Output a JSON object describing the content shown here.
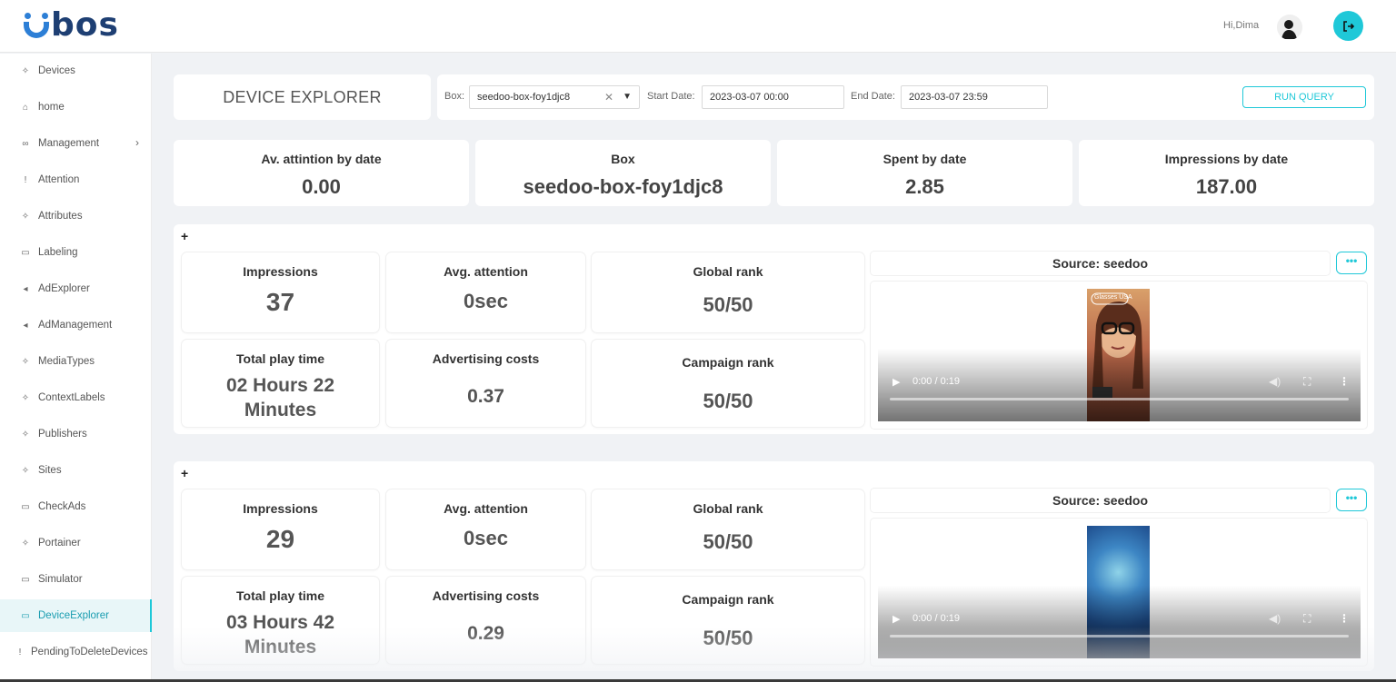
{
  "header": {
    "logo_text": "bos",
    "greeting": "Hi,Dima",
    "brand_color": "#1e3f73",
    "accent_color": "#1fc8d8",
    "avatar_icon": "user-avatar",
    "logout_icon": "logout-icon"
  },
  "sidebar": {
    "items": [
      {
        "label": "Devices",
        "icon": "sparkle-icon"
      },
      {
        "label": "home",
        "icon": "home-icon"
      },
      {
        "label": "Management",
        "icon": "users-icon"
      },
      {
        "label": "Attention",
        "icon": "exclamation-icon"
      },
      {
        "label": "Attributes",
        "icon": "sparkle-icon"
      },
      {
        "label": "Labeling",
        "icon": "tag-icon"
      },
      {
        "label": "AdExplorer",
        "icon": "megaphone-icon"
      },
      {
        "label": "AdManagement",
        "icon": "megaphone-icon"
      },
      {
        "label": "MediaTypes",
        "icon": "sparkle-icon"
      },
      {
        "label": "ContextLabels",
        "icon": "sparkle-icon"
      },
      {
        "label": "Publishers",
        "icon": "sparkle-icon"
      },
      {
        "label": "Sites",
        "icon": "sparkle-icon"
      },
      {
        "label": "CheckAds",
        "icon": "tag-icon"
      },
      {
        "label": "Portainer",
        "icon": "sparkle-icon"
      },
      {
        "label": "Simulator",
        "icon": "tag-icon"
      },
      {
        "label": "DeviceExplorer",
        "icon": "tag-icon"
      },
      {
        "label": "PendingToDeleteDevices",
        "icon": "exclamation-icon"
      }
    ],
    "active": "DeviceExplorer"
  },
  "page": {
    "title": "DEVICE EXPLORER"
  },
  "filters": {
    "box_label": "Box:",
    "box_value": "seedoo-box-foy1djc8",
    "start_label": "Start Date:",
    "start_value": "2023-03-07 00:00",
    "end_label": "End Date:",
    "end_value": "2023-03-07 23:59",
    "run_label": "RUN QUERY"
  },
  "stats": [
    {
      "title": "Av. attintion by date",
      "value": "0.00"
    },
    {
      "title": "Box",
      "value": "seedoo-box-foy1djc8"
    },
    {
      "title": "Spent by date",
      "value": "2.85"
    },
    {
      "title": "Impressions by date",
      "value": "187.00"
    }
  ],
  "ads": [
    {
      "toggle": "+",
      "impressions_title": "Impressions",
      "impressions": "37",
      "attention_title": "Avg. attention",
      "attention": "0sec",
      "global_rank_title": "Global rank",
      "global_rank": "50/50",
      "play_time_title": "Total play time",
      "play_time": "02 Hours 22 Minutes",
      "costs_title": "Advertising costs",
      "costs": "0.37",
      "campaign_rank_title": "Campaign rank",
      "campaign_rank": "50/50",
      "source": "Source: seedoo",
      "more": "•••",
      "video_time": "0:00 / 0:19",
      "thumb_caption": "Glasses USA"
    },
    {
      "toggle": "+",
      "impressions_title": "Impressions",
      "impressions": "29",
      "attention_title": "Avg. attention",
      "attention": "0sec",
      "global_rank_title": "Global rank",
      "global_rank": "50/50",
      "play_time_title": "Total play time",
      "play_time": "03 Hours 42 Minutes",
      "costs_title": "Advertising costs",
      "costs": "0.29",
      "campaign_rank_title": "Campaign rank",
      "campaign_rank": "50/50",
      "source": "Source: seedoo",
      "more": "•••",
      "video_time": "0:00 / 0:19",
      "thumb_caption": ""
    }
  ]
}
